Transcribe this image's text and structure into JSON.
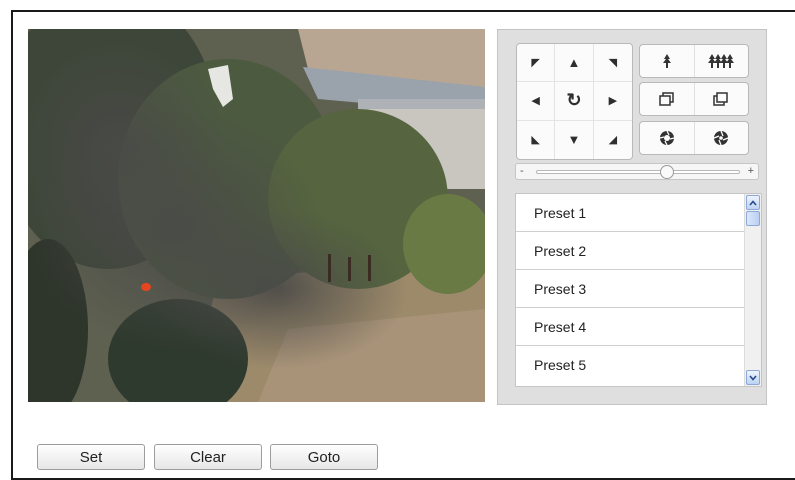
{
  "ptz": {
    "direction_icons": [
      "arrow-up-left-icon",
      "arrow-up-icon",
      "arrow-up-right-icon",
      "arrow-left-icon",
      "auto-rotate-icon",
      "arrow-right-icon",
      "arrow-down-left-icon",
      "arrow-down-icon",
      "arrow-down-right-icon"
    ],
    "direction_glyphs": [
      "◤",
      "▲",
      "◥",
      "◀",
      "↻",
      "▶",
      "◣",
      "▼",
      "◢"
    ],
    "zoom_slider": {
      "min_label": "-",
      "max_label": "+",
      "value_fraction": 0.64
    }
  },
  "presets": {
    "items": [
      {
        "label": "Preset 1"
      },
      {
        "label": "Preset 2"
      },
      {
        "label": "Preset 3"
      },
      {
        "label": "Preset 4"
      },
      {
        "label": "Preset 5"
      }
    ]
  },
  "actions": {
    "set_label": "Set",
    "clear_label": "Clear",
    "goto_label": "Goto"
  },
  "colors": {
    "panel_bg": "#dfdfdf",
    "scroll_accent": "#8fa9d6"
  }
}
